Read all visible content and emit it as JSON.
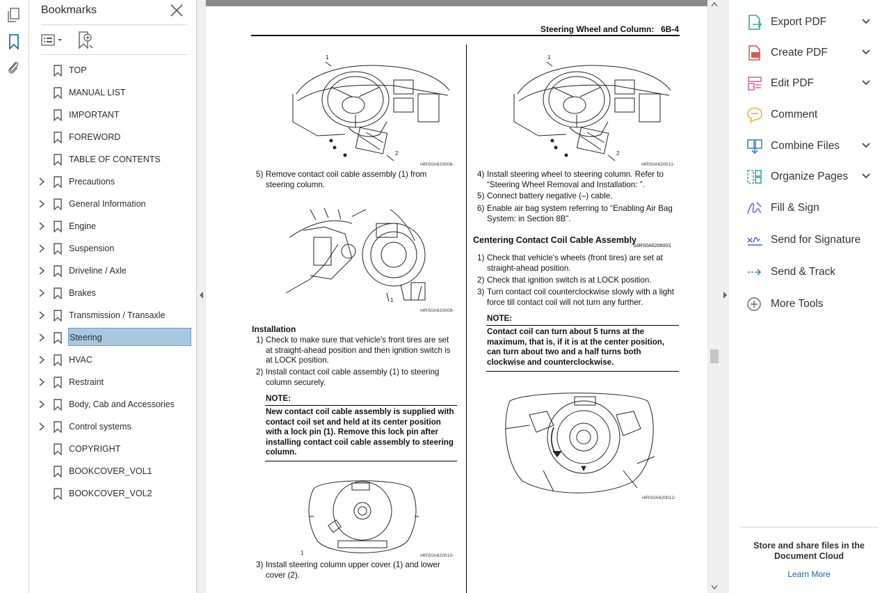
{
  "bookmarks_panel": {
    "title": "Bookmarks",
    "items": [
      {
        "label": "TOP",
        "expandable": false
      },
      {
        "label": "MANUAL LIST",
        "expandable": false
      },
      {
        "label": "IMPORTANT",
        "expandable": false
      },
      {
        "label": "FOREWORD",
        "expandable": false
      },
      {
        "label": "TABLE OF CONTENTS",
        "expandable": false
      },
      {
        "label": "Precautions",
        "expandable": true
      },
      {
        "label": "General Information",
        "expandable": true
      },
      {
        "label": "Engine",
        "expandable": true
      },
      {
        "label": "Suspension",
        "expandable": true
      },
      {
        "label": "Driveline / Axle",
        "expandable": true
      },
      {
        "label": "Brakes",
        "expandable": true
      },
      {
        "label": "Transmission / Transaxle",
        "expandable": true
      },
      {
        "label": "Steering",
        "expandable": true,
        "selected": true
      },
      {
        "label": "HVAC",
        "expandable": true
      },
      {
        "label": "Restraint",
        "expandable": true
      },
      {
        "label": "Body, Cab and Accessories",
        "expandable": true
      },
      {
        "label": "Control systems",
        "expandable": true
      },
      {
        "label": "COPYRIGHT",
        "expandable": false
      },
      {
        "label": "BOOKCOVER_VOL1",
        "expandable": false
      },
      {
        "label": "BOOKCOVER_VOL2",
        "expandable": false
      }
    ]
  },
  "page": {
    "header_title": "Steering Wheel and Column:",
    "header_page": "6B-4",
    "left": {
      "fig1_caption": "I4RS0A620008-",
      "fig1_callout1": "1",
      "fig1_callout2": "2",
      "step5_num": "5)",
      "step5_text": "Remove contact coil cable assembly (1) from steering column.",
      "fig2_caption": "I4RS0A620009-",
      "fig2_callout1": "1",
      "installation_heading": "Installation",
      "inst1_num": "1)",
      "inst1_text": "Check to make sure that vehicle's front tires are set at straight-ahead position and then ignition switch is at LOCK position.",
      "inst2_num": "2)",
      "inst2_text": "Install contact coil cable assembly (1) to steering column securely.",
      "note_title": "NOTE:",
      "note_text": "New contact coil cable assembly is supplied with contact coil set and held at its center position with a lock pin (1). Remove this lock pin after installing contact coil cable assembly to steering column.",
      "fig3_caption": "I4RS0A620010-",
      "fig3_callout1": "1",
      "step3_num": "3)",
      "step3_text": "Install steering column upper cover (1) and lower cover (2)."
    },
    "right": {
      "fig1_caption": "I4RS0A620011-",
      "fig1_callout1": "1",
      "fig1_callout2": "2",
      "step4_num": "4)",
      "step4_text": "Install steering wheel to steering column. Refer to “Steering Wheel Removal and Installation: ”.",
      "step5_num": "5)",
      "step5_text": "Connect battery negative (–) cable.",
      "step6_num": "6)",
      "step6_text": "Enable air bag system referring to “Enabling Air Bag System:  in Section 8B”.",
      "centering_heading": "Centering Contact Coil Cable Assembly",
      "centering_code": "S4RS0A6206003",
      "c1_num": "1)",
      "c1_text": "Check that vehicle's wheels (front tires) are set at straight-ahead position.",
      "c2_num": "2)",
      "c2_text": "Check that ignition switch is at LOCK position.",
      "c3_num": "3)",
      "c3_text": "Turn contact coil counterclockwise slowly with a light force till contact coil will not turn any further.",
      "note_title": "NOTE:",
      "note_text": "Contact coil can turn about 5 turns at the maximum, that is, if it is at the center position, can turn about two and a half turns both clockwise and counterclockwise.",
      "fig2_caption": "I4RS0A620012-"
    }
  },
  "tools_panel": {
    "items": [
      {
        "label": "Export PDF",
        "icon": "export-pdf-icon",
        "color": "#2fa89e",
        "has_menu": true
      },
      {
        "label": "Create PDF",
        "icon": "create-pdf-icon",
        "color": "#e0544b",
        "has_menu": true
      },
      {
        "label": "Edit PDF",
        "icon": "edit-pdf-icon",
        "color": "#d85fb0",
        "has_menu": true
      },
      {
        "label": "Comment",
        "icon": "comment-icon",
        "color": "#f2b230",
        "has_menu": false
      },
      {
        "label": "Combine Files",
        "icon": "combine-files-icon",
        "color": "#3b7fd6",
        "has_menu": true
      },
      {
        "label": "Organize Pages",
        "icon": "organize-pages-icon",
        "color": "#2fa89e",
        "has_menu": true
      },
      {
        "label": "Fill & Sign",
        "icon": "fill-sign-icon",
        "color": "#7c62d9",
        "has_menu": false
      },
      {
        "label": "Send for Signature",
        "icon": "send-signature-icon",
        "color": "#4a5fd0",
        "has_menu": false
      },
      {
        "label": "Send & Track",
        "icon": "send-track-icon",
        "color": "#3b7fd6",
        "has_menu": false
      },
      {
        "label": "More Tools",
        "icon": "more-tools-icon",
        "color": "#6a6a6a",
        "has_menu": false
      }
    ],
    "cloud_text": "Store and share files in the Document Cloud",
    "cloud_link": "Learn More"
  }
}
